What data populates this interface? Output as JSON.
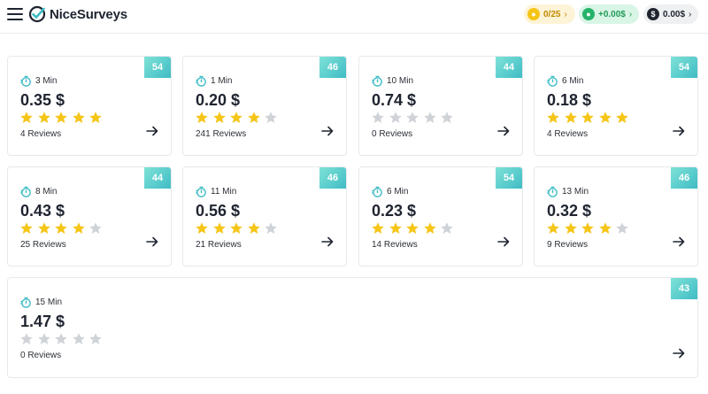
{
  "header": {
    "logo_text": "NiceSurveys",
    "progress": "0/25",
    "earnings": "+0.00$",
    "balance": "0.00$"
  },
  "colors": {
    "accent": "#3fbcc5",
    "star_filled": "#f5c518",
    "star_empty": "#cfd3d7"
  },
  "surveys": [
    {
      "badge": "54",
      "time": "3 Min",
      "price": "0.35 $",
      "rating": 5,
      "reviews": "4 Reviews"
    },
    {
      "badge": "46",
      "time": "1 Min",
      "price": "0.20 $",
      "rating": 4,
      "reviews": "241 Reviews"
    },
    {
      "badge": "44",
      "time": "10 Min",
      "price": "0.74 $",
      "rating": 0,
      "reviews": "0 Reviews"
    },
    {
      "badge": "54",
      "time": "6 Min",
      "price": "0.18 $",
      "rating": 5,
      "reviews": "4 Reviews"
    },
    {
      "badge": "44",
      "time": "8 Min",
      "price": "0.43 $",
      "rating": 4,
      "reviews": "25 Reviews"
    },
    {
      "badge": "46",
      "time": "11 Min",
      "price": "0.56 $",
      "rating": 4,
      "reviews": "21 Reviews"
    },
    {
      "badge": "54",
      "time": "6 Min",
      "price": "0.23 $",
      "rating": 4,
      "reviews": "14 Reviews"
    },
    {
      "badge": "46",
      "time": "13 Min",
      "price": "0.32 $",
      "rating": 4,
      "reviews": "9 Reviews"
    },
    {
      "badge": "43",
      "time": "15 Min",
      "price": "1.47 $",
      "rating": 0,
      "reviews": "0 Reviews"
    }
  ]
}
